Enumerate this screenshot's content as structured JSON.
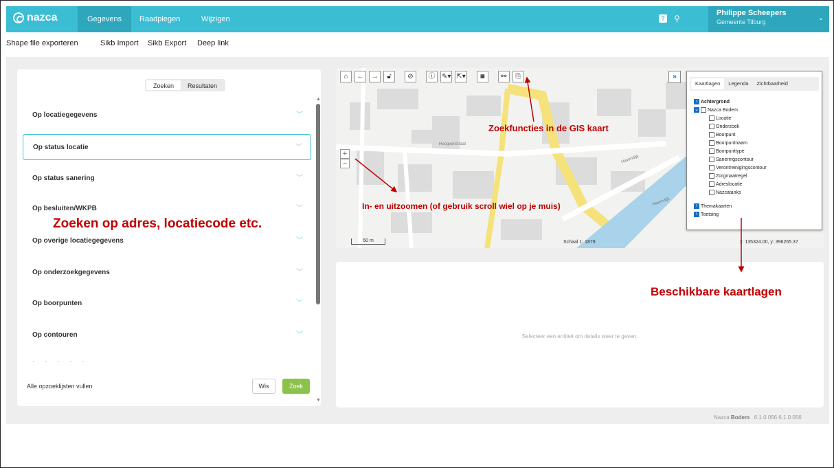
{
  "topbar": {
    "logo": "nazca",
    "tabs": [
      {
        "label": "Gegevens",
        "active": true
      },
      {
        "label": "Raadplegen",
        "active": false
      },
      {
        "label": "Wijzigen",
        "active": false
      }
    ],
    "help_label": "?",
    "user_name": "Philippe Scheepers",
    "user_org": "Gemeente Tilburg",
    "accent_color": "#3bbdd4"
  },
  "submenu": [
    "Shape file exporteren",
    "Sikb Import",
    "Sikb Export",
    "Deep link"
  ],
  "search_panel": {
    "segments": [
      "Zoeken",
      "Resultaten"
    ],
    "filters": [
      "Op locatiegegevens",
      "Op status locatie",
      "Op status sanering",
      "Op besluiten/WKPB",
      "Op overige locatiegegevens",
      "Op onderzoekgegevens",
      "Op boorpunten",
      "Op contouren"
    ],
    "selected_filter": "Op status locatie",
    "fill_label": "Alle opzoeklijsten vullen",
    "clear_button": "Wis",
    "search_button": "Zoek"
  },
  "map": {
    "scale_bar": "50 m",
    "scale": "Schaal 1: 1879",
    "coords": "x: 135324.00, y: 396265.37",
    "streets": [
      "Hoogvenstraat",
      "Havendijk",
      "Havendijk"
    ],
    "zoom_in": "+",
    "zoom_out": "−"
  },
  "layers": {
    "tabs": [
      "Kaartlagen",
      "Legenda",
      "Zichtbaarheid"
    ],
    "background": "Achtergrond",
    "group": "Nazca Bodem",
    "items": [
      "Locatie",
      "Onderzoek",
      "Boorpunt",
      "Boorpuntnaam",
      "Boorpunttype",
      "Saneringscontour",
      "Verontreinigingscontour",
      "Zorgmaatregel",
      "Adreslocatie",
      "Nazcatanks"
    ],
    "themes": "Themakaarten",
    "testing": "Toetsing"
  },
  "details": {
    "empty_text": "Selecteer een entiteit om details weer te geven."
  },
  "footer": {
    "product_prefix": "Nazca",
    "product_bold": "Bodem",
    "version": "6.1.0.056 6.1.0.056"
  },
  "annotations": {
    "search_text": "Zoeken op adres, locatiecode etc.",
    "gis_text": "Zoekfuncties in de GIS kaart",
    "zoom_text": "In- en uitzoomen (of gebruik scroll wiel op je muis)",
    "layers_text": "Beschikbare kaartlagen",
    "color": "#c00000"
  }
}
